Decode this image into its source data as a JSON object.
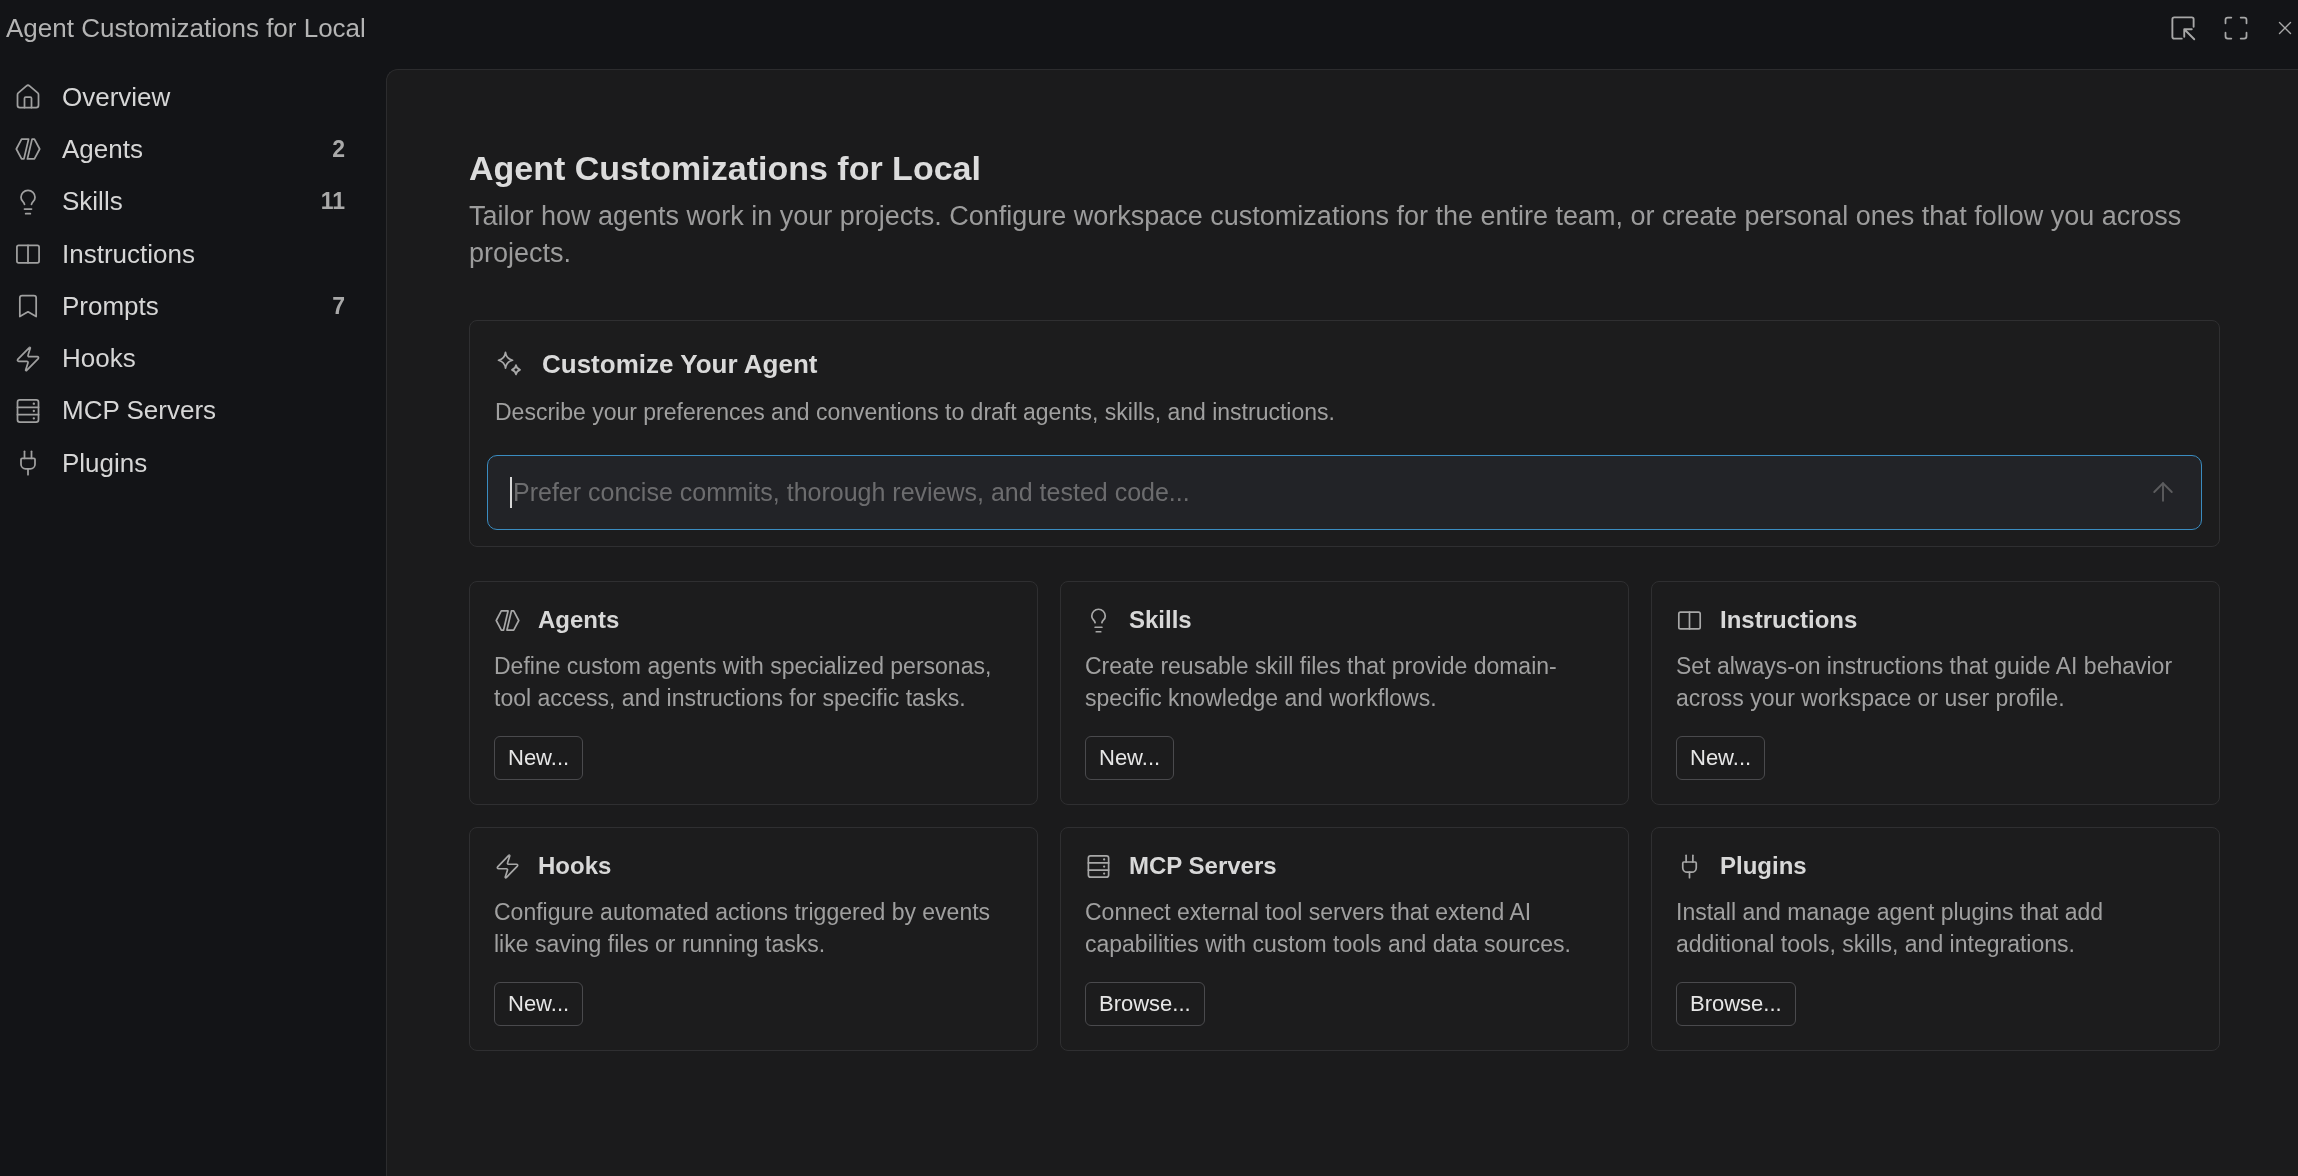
{
  "window": {
    "title": "Agent Customizations for Local"
  },
  "sidebar": {
    "items": [
      {
        "label": "Overview",
        "selected": false
      },
      {
        "label": "Agents",
        "count": "2",
        "selected": false
      },
      {
        "label": "Skills",
        "count": "11",
        "selected": false
      },
      {
        "label": "Instructions",
        "selected": false
      },
      {
        "label": "Prompts",
        "count": "7",
        "selected": false
      },
      {
        "label": "Hooks",
        "selected": false
      },
      {
        "label": "MCP Servers",
        "selected": false
      },
      {
        "label": "Plugins",
        "selected": false
      }
    ]
  },
  "main": {
    "heading": "Agent Customizations for Local",
    "description": "Tailor how agents work in your projects. Configure workspace customizations for the entire team, or create personal ones that follow you across projects.",
    "customize": {
      "title": "Customize Your Agent",
      "description": "Describe your preferences and conventions to draft agents, skills, and instructions.",
      "input": {
        "placeholder": "Prefer concise commits, thorough reviews, and tested code...",
        "focused": true
      }
    },
    "cards": [
      {
        "title": "Agents",
        "description": "Define custom agents with specialized personas, tool access, and instructions for specific tasks.",
        "button": "New..."
      },
      {
        "title": "Skills",
        "description": "Create reusable skill files that provide domain-specific knowledge and workflows.",
        "button": "New..."
      },
      {
        "title": "Instructions",
        "description": "Set always-on instructions that guide AI behavior across your workspace or user profile.",
        "button": "New..."
      },
      {
        "title": "Hooks",
        "description": "Configure automated actions triggered by events like saving files or running tasks.",
        "button": "New..."
      },
      {
        "title": "MCP Servers",
        "description": "Connect external tool servers that extend AI capabilities with custom tools and data sources.",
        "button": "Browse..."
      },
      {
        "title": "Plugins",
        "description": "Install and manage agent plugins that add additional tools, skills, and integrations.",
        "button": "Browse..."
      }
    ]
  }
}
